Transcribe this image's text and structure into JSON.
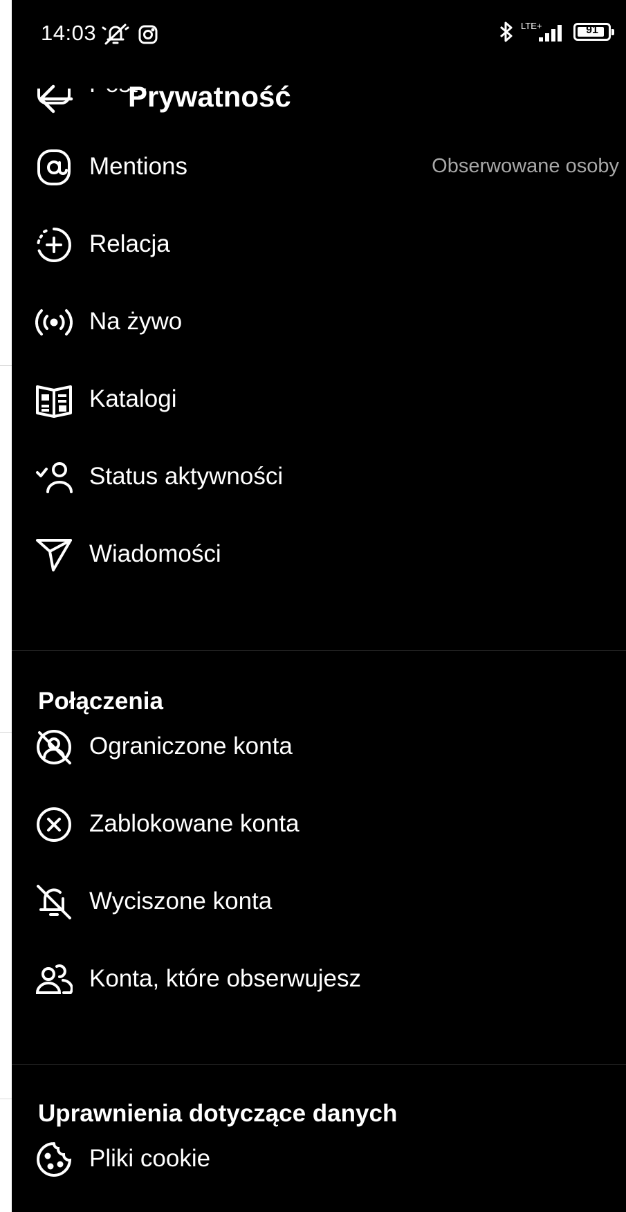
{
  "status_bar": {
    "time": "14:03",
    "network": "LTE+",
    "battery": "91",
    "battery_level": 0.91
  },
  "header": {
    "title": "Prywatność"
  },
  "partial_row": {
    "label": "Posty"
  },
  "interactions": [
    {
      "icon": "at-sign-icon",
      "label": "Mentions",
      "value": "Obserwowane osoby"
    },
    {
      "icon": "story-add-icon",
      "label": "Relacja"
    },
    {
      "icon": "live-broadcast-icon",
      "label": "Na żywo"
    },
    {
      "icon": "catalog-book-icon",
      "label": "Katalogi"
    },
    {
      "icon": "activity-status-icon",
      "label": "Status aktywności"
    },
    {
      "icon": "paper-plane-icon",
      "label": "Wiadomości"
    }
  ],
  "connections": {
    "title": "Połączenia",
    "items": [
      {
        "icon": "restricted-icon",
        "label": "Ograniczone konta"
      },
      {
        "icon": "blocked-icon",
        "label": "Zablokowane konta"
      },
      {
        "icon": "muted-bell-icon",
        "label": "Wyciszone konta"
      },
      {
        "icon": "following-users-icon",
        "label": "Konta, które obserwujesz"
      }
    ]
  },
  "data_permissions": {
    "title": "Uprawnienia dotyczące danych",
    "items": [
      {
        "icon": "cookie-icon",
        "label": "Pliki cookie"
      }
    ]
  }
}
